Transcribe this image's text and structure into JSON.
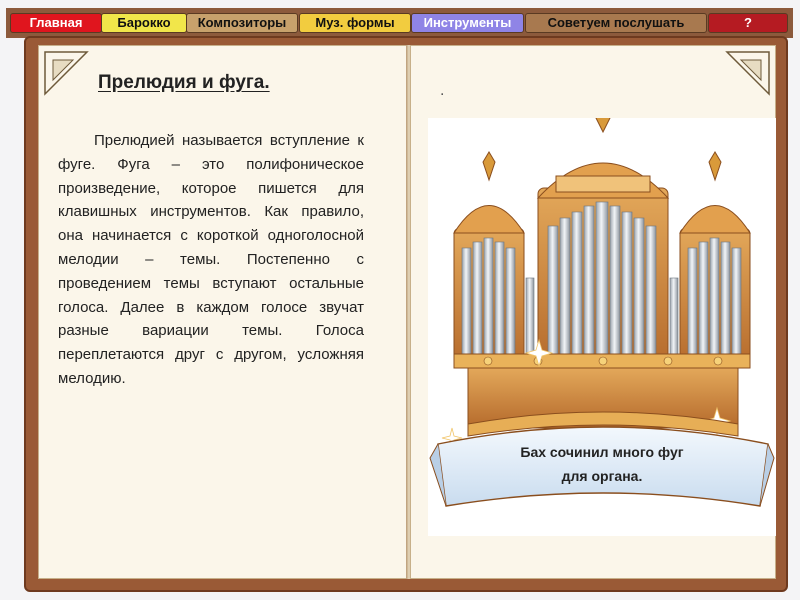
{
  "nav": {
    "items": [
      {
        "label": "Главная",
        "bg": "#e0151e",
        "color": "#ffffff"
      },
      {
        "label": "Барокко",
        "bg": "#f1e64a",
        "color": "#111111"
      },
      {
        "label": "Композиторы",
        "bg": "#c7a16c",
        "color": "#111111"
      },
      {
        "label": "Муз. формы",
        "bg": "#f2cc3f",
        "color": "#111111"
      },
      {
        "label": "Инструменты",
        "bg": "#8f84e6",
        "color": "#ffffff"
      },
      {
        "label": "Советуем послушать",
        "bg": "#a8794f",
        "color": "#111111"
      },
      {
        "label": "?",
        "bg": "#b51b22",
        "color": "#ffffff"
      }
    ]
  },
  "page": {
    "title": "Прелюдия и фуга.",
    "body": "Прелюдией называется вступление к фуге. Фуга – это полифоническое произведение, которое пишется для клавишных инструментов. Как правило, она начинается с короткой одноголосной мелодии – темы. Постепенно с проведением темы вступают остальные голоса. Далее в каждом голосе звучат разные вариации темы. Голоса переплетаются друг с другом, усложняя мелодию."
  },
  "illustration": {
    "icon": "pipe-organ-icon",
    "caption_line1": "Бах сочинил много фуг",
    "caption_line2": "для органа."
  },
  "colors": {
    "book": "#9a5a36",
    "page": "#fbf6ea",
    "organ_gold": "#d99a3a",
    "organ_wood": "#c8803c",
    "pipe": "#c9cfd6",
    "banner": "#dbe9f6"
  }
}
